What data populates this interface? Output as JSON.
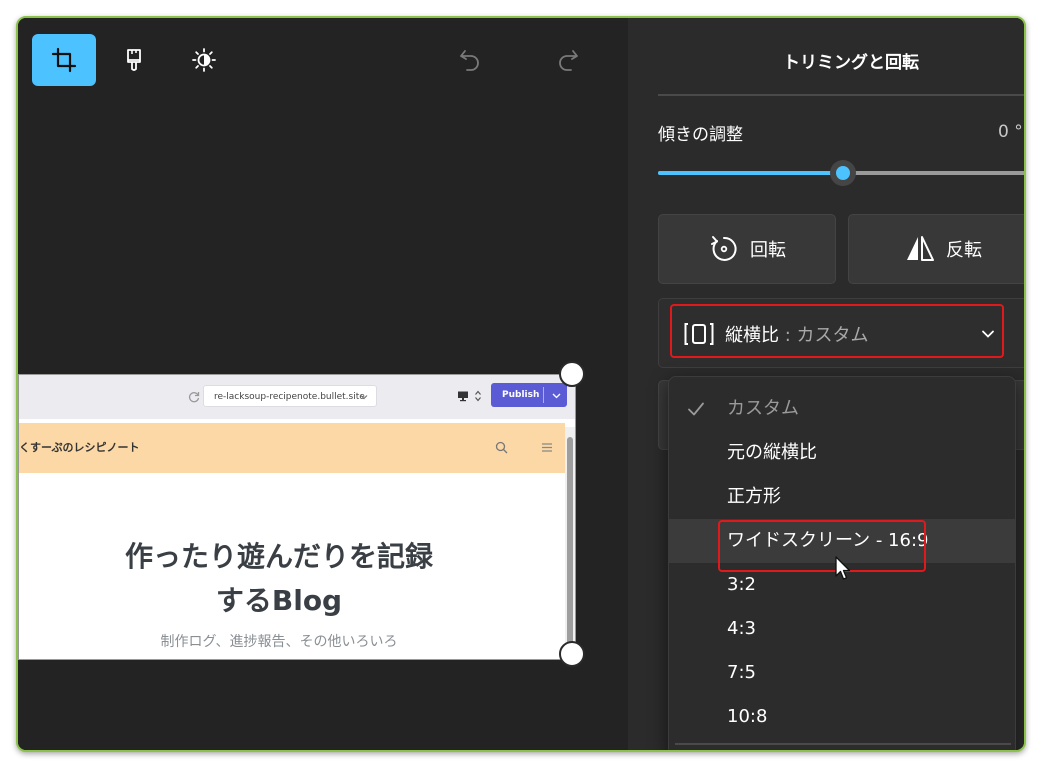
{
  "window": {
    "panel_title": "トリミングと回転"
  },
  "toolbar": {
    "tools": [
      {
        "name": "crop-icon",
        "active": true
      },
      {
        "name": "markup-brush-icon",
        "active": false
      },
      {
        "name": "brightness-icon",
        "active": false
      }
    ],
    "undo_icon": "undo-icon",
    "redo_icon": "redo-icon"
  },
  "preview": {
    "url": "re-lacksoup-recipenote.bullet.site",
    "publish_label": "Publish",
    "site_name": "くすーぷのレシピノート",
    "hero_title_line1": "作ったり遊んだりを記録",
    "hero_title_line2": "するBlog",
    "hero_subtitle": "制作ログ、進捗報告、その他いろいろ"
  },
  "tilt": {
    "label": "傾きの調整",
    "value": "0 °",
    "slider_fraction": 0.5
  },
  "actions": {
    "rotate_label": "回転",
    "flip_label": "反転"
  },
  "aspect": {
    "label": "縦横比",
    "separator": " : ",
    "current": "カスタム"
  },
  "dropdown": {
    "items": [
      {
        "label": "カスタム",
        "selected": true
      },
      {
        "label": "元の縦横比",
        "selected": false
      },
      {
        "label": "正方形",
        "selected": false
      },
      {
        "label": "ワイドスクリーン - 16:9",
        "selected": false,
        "hovered": true
      },
      {
        "label": "3:2",
        "selected": false
      },
      {
        "label": "4:3",
        "selected": false
      },
      {
        "label": "7:5",
        "selected": false
      },
      {
        "label": "10:8",
        "selected": false
      }
    ]
  },
  "colors": {
    "accent": "#4cc2ff",
    "highlight": "#e0191c",
    "frame_border": "#8bc34a",
    "publish": "#5b5bd6",
    "site_header": "#fbd8a5"
  }
}
